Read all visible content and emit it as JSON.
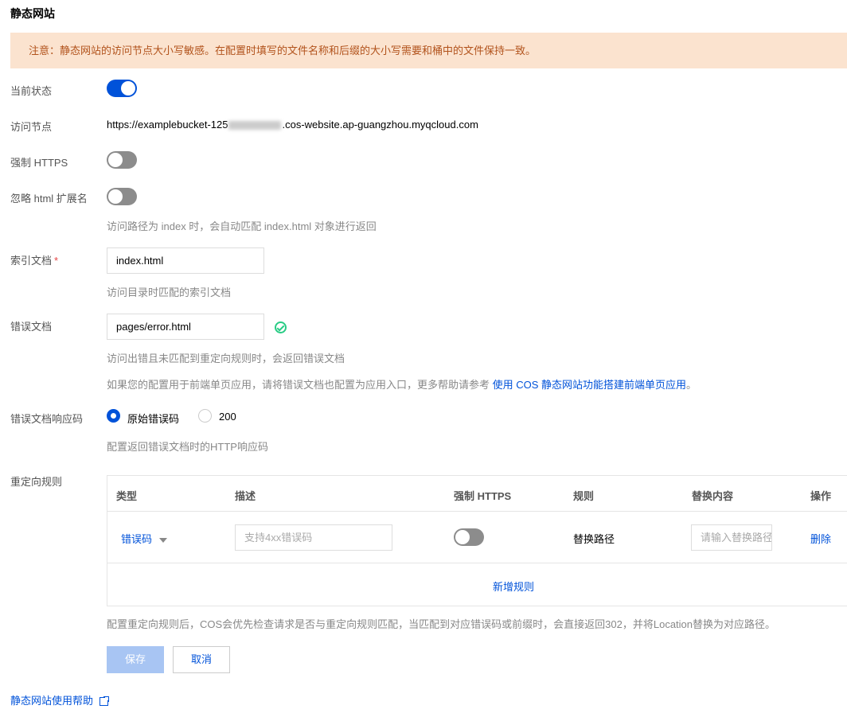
{
  "page": {
    "title": "静态网站",
    "notice": "注意：静态网站的访问节点大小写敏感。在配置时填写的文件名称和后缀的大小写需要和桶中的文件保持一致。"
  },
  "status": {
    "label": "当前状态",
    "enabled": true
  },
  "endpoint": {
    "label": "访问节点",
    "prefix": "https://examplebucket-125",
    "suffix": ".cos-website.ap-guangzhou.myqcloud.com"
  },
  "force_https": {
    "label": "强制 HTTPS",
    "enabled": false
  },
  "ignore_html": {
    "label": "忽略 html 扩展名",
    "enabled": false,
    "hint": "访问路径为 index 时，会自动匹配 index.html 对象进行返回"
  },
  "index_doc": {
    "label": "索引文档",
    "required_mark": "*",
    "value": "index.html",
    "hint": "访问目录时匹配的索引文档"
  },
  "error_doc": {
    "label": "错误文档",
    "value": "pages/error.html",
    "hint": "访问出错且未匹配到重定向规则时，会返回错误文档",
    "hint2_prefix": "如果您的配置用于前端单页应用，请将错误文档也配置为应用入口，更多帮助请参考 ",
    "hint2_link": "使用 COS 静态网站功能搭建前端单页应用",
    "hint2_suffix": "。"
  },
  "error_code": {
    "label": "错误文档响应码",
    "options": [
      "原始错误码",
      "200"
    ],
    "selected": "原始错误码",
    "hint": "配置返回错误文档时的HTTP响应码"
  },
  "redirect": {
    "label": "重定向规则",
    "columns": [
      "类型",
      "描述",
      "强制 HTTPS",
      "规则",
      "替换内容",
      "操作"
    ],
    "rows": [
      {
        "type": "错误码",
        "desc_placeholder": "支持4xx错误码",
        "force_https": false,
        "rule": "替换路径",
        "replace_placeholder": "请输入替换路径",
        "action": "删除"
      }
    ],
    "add_label": "新增规则",
    "hint": "配置重定向规则后，COS会优先检查请求是否与重定向规则匹配，当匹配到对应错误码或前缀时，会直接返回302，并将Location替换为对应路径。"
  },
  "buttons": {
    "save": "保存",
    "cancel": "取消"
  },
  "help": {
    "label": "静态网站使用帮助"
  },
  "colors": {
    "primary": "#0052d9",
    "notice_bg": "#fbe3cf",
    "notice_text": "#b2531c",
    "success": "#29cc85"
  }
}
